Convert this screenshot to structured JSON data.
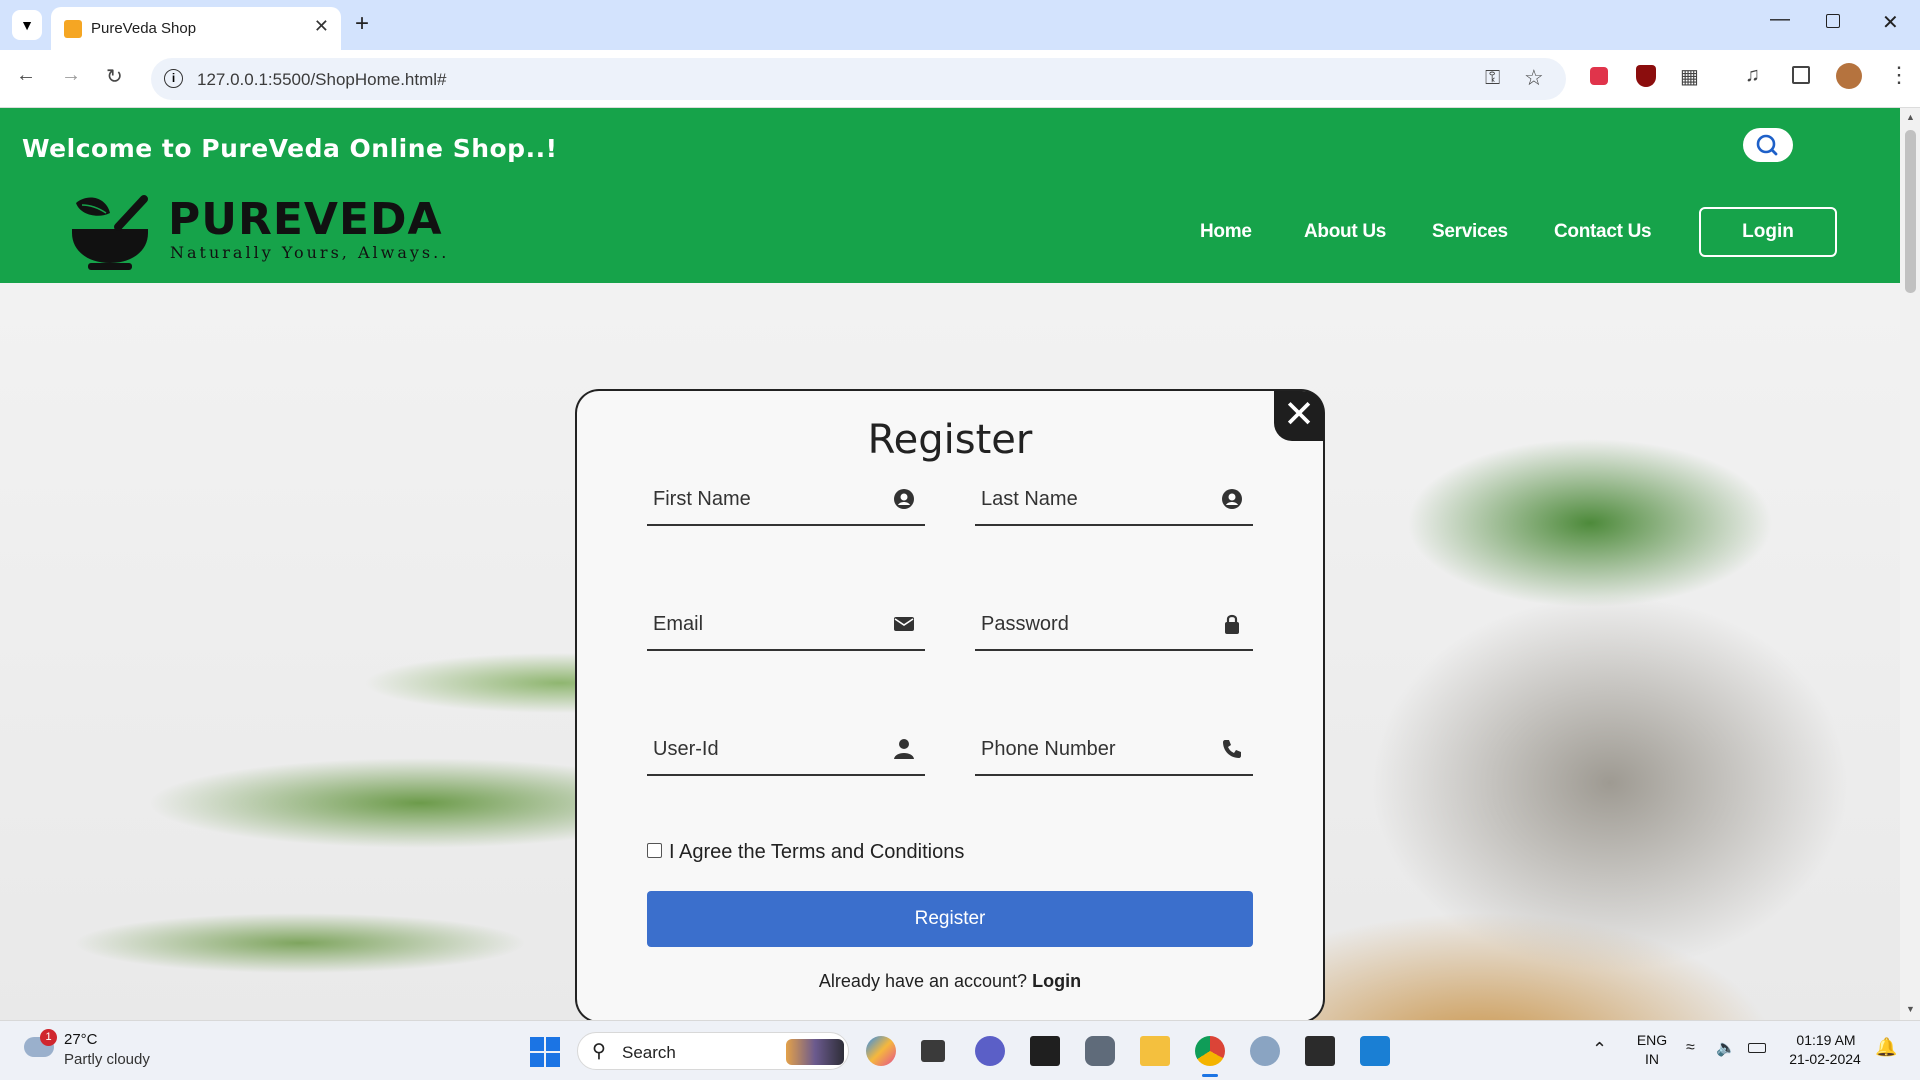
{
  "browser": {
    "tab_title": "PureVeda Shop",
    "url": "127.0.0.1:5500/ShopHome.html#"
  },
  "header": {
    "welcome": "Welcome to PureVeda Online Shop..!",
    "brand": "PUREVEDA",
    "tagline": "Naturally Yours, Always..",
    "nav": [
      "Home",
      "About Us",
      "Services",
      "Contact Us"
    ],
    "login": "Login"
  },
  "modal": {
    "title": "Register",
    "fields": {
      "first_name": "First Name",
      "last_name": "Last Name",
      "email": "Email",
      "password": "Password",
      "user_id": "User-Id",
      "phone": "Phone Number"
    },
    "terms": "I Agree the Terms and Conditions",
    "register_button": "Register",
    "already": "Already have an account?",
    "login_link": "Login"
  },
  "taskbar": {
    "temperature": "27°C",
    "weather": "Partly cloudy",
    "weather_badge": "1",
    "search": "Search",
    "lang": "ENG",
    "region": "IN",
    "time": "01:19 AM",
    "date": "21-02-2024"
  },
  "colors": {
    "header_green": "#16a34a",
    "register_blue": "#3b6fcc"
  }
}
